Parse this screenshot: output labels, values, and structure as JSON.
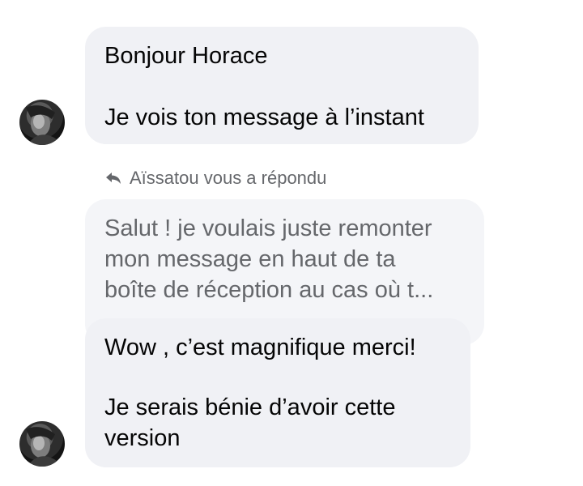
{
  "conversation": {
    "message_1": {
      "lines": [
        "Bonjour Horace",
        "",
        "Je vois ton message à l’instant"
      ]
    },
    "reply_indicator": {
      "icon": "reply-arrow-icon",
      "text": "Aïssatou vous a répondu"
    },
    "quoted_message": {
      "lines": [
        "Salut ! je voulais juste remonter",
        "mon message en haut de ta",
        "boîte de réception au cas où t..."
      ]
    },
    "message_2": {
      "lines": [
        "Wow ,  c’est magnifique merci!",
        "",
        "Je serais bénie d’avoir cette",
        "version"
      ]
    },
    "avatar": {
      "icon": "user-avatar-icon"
    },
    "colors": {
      "bubble_background": "#f0f1f5",
      "secondary_text": "#65676b",
      "primary_text": "#050505"
    }
  }
}
